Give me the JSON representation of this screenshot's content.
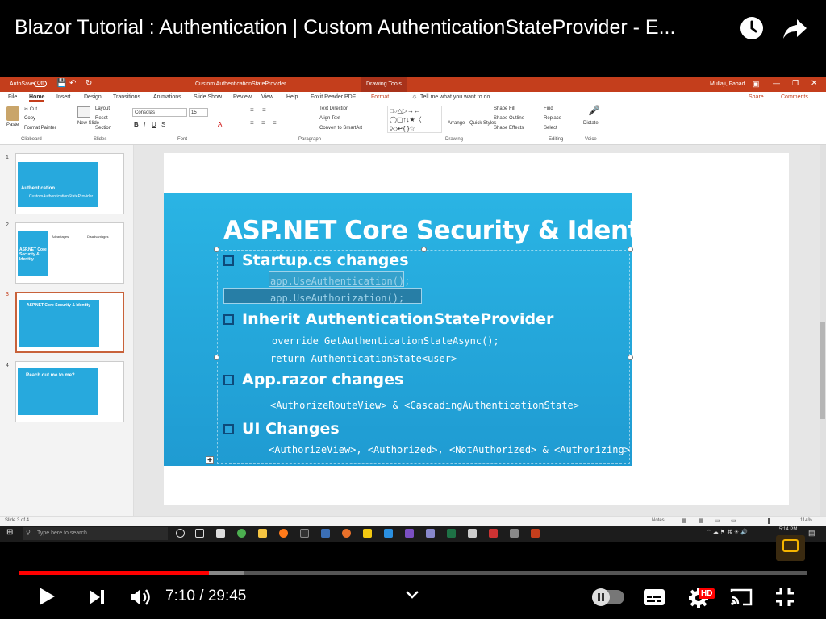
{
  "video": {
    "title": "Blazor Tutorial : Authentication | Custom AuthenticationStateProvider - E...",
    "current_time": "7:10",
    "separator": "/",
    "duration": "29:45",
    "time_display": "7:10 / 29:45",
    "progress": 0.241,
    "buffered": 0.286,
    "hd_badge": "HD"
  },
  "ppt": {
    "autosave": "AutoSave",
    "autosave_state": "Off",
    "doc_title": "Custom AuthenticationStateProvider",
    "context_tab": "Drawing Tools",
    "user": "Mullaji, Fahad",
    "tabs": [
      "File",
      "Home",
      "Insert",
      "Design",
      "Transitions",
      "Animations",
      "Slide Show",
      "Review",
      "View",
      "Help",
      "Foxit Reader PDF",
      "Format"
    ],
    "tell_me": "Tell me what you want to do",
    "share": "Share",
    "comments": "Comments",
    "ribbon": {
      "paste": "Paste",
      "cut": "Cut",
      "copy": "Copy",
      "format_painter": "Format Painter",
      "new_slide": "New Slide",
      "layout": "Layout",
      "reset": "Reset",
      "section": "Section",
      "font_name": "Consolas",
      "font_size": "15",
      "text_direction": "Text Direction",
      "align_text": "Align Text",
      "convert_smartart": "Convert to SmartArt",
      "arrange": "Arrange",
      "quick_styles": "Quick Styles",
      "shape_fill": "Shape Fill",
      "shape_outline": "Shape Outline",
      "shape_effects": "Shape Effects",
      "find": "Find",
      "replace": "Replace",
      "select": "Select",
      "dictate": "Dictate",
      "groups": [
        "Clipboard",
        "Slides",
        "Font",
        "Paragraph",
        "Drawing",
        "Editing",
        "Voice"
      ]
    },
    "thumbnails": [
      {
        "num": "1",
        "title": "Authentication",
        "subtitle": "CustomAuthenticationStateProvider"
      },
      {
        "num": "2",
        "title": "ASP.NET Core Security & Identity",
        "col1": "Advantages",
        "col2": "Disadvantages"
      },
      {
        "num": "3",
        "title": "ASP.NET Core Security & Identity",
        "selected": true
      },
      {
        "num": "4",
        "title": "Reach out me to me?"
      }
    ],
    "slide": {
      "heading": "ASP.NET Core Security & Identity",
      "sections": [
        {
          "title": "Startup.cs changes",
          "lines": [
            "app.UseAuthentication();",
            "app.UseAuthorization();"
          ]
        },
        {
          "title": "Inherit AuthenticationStateProvider",
          "lines": [
            "override GetAuthenticationStateAsync();",
            "return AuthenticationState<user>"
          ]
        },
        {
          "title": "App.razor changes",
          "lines": [
            "<AuthorizeRouteView> & <CascadingAuthenticationState>"
          ]
        },
        {
          "title": "UI Changes",
          "lines": [
            "<AuthorizeView>, <Authorized>, <NotAuthorized> & <Authorizing>"
          ]
        }
      ]
    },
    "status": {
      "slide_of": "Slide 3 of 4",
      "notes": "Notes",
      "zoom": "114%"
    },
    "taskbar": {
      "search_placeholder": "Type here to search",
      "clock": "5:14 PM"
    }
  },
  "colors": {
    "ppt_accent": "#c43e1c",
    "slide_blue": "#27a9dd",
    "yt_red": "#ff0000"
  }
}
